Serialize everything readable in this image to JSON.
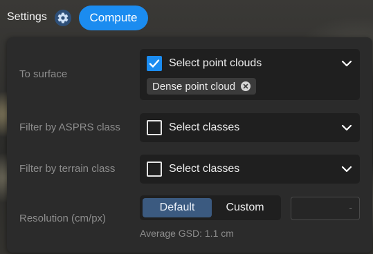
{
  "topbar": {
    "settings_label": "Settings",
    "compute_label": "Compute"
  },
  "icons": {
    "gear": "gear-icon",
    "check": "checkmark-icon",
    "chevron": "chevron-down-icon",
    "chip_remove": "close-circle-icon"
  },
  "colors": {
    "accent": "#1b8cf0",
    "segment_active": "#3b5a80",
    "panel": "#2b2b2b"
  },
  "rows": {
    "surface": {
      "label": "To surface",
      "checked": true,
      "select_text": "Select point clouds",
      "chips": [
        "Dense point cloud"
      ]
    },
    "asprs": {
      "label": "Filter by ASPRS class",
      "checked": false,
      "select_text": "Select classes"
    },
    "terrain": {
      "label": "Filter by terrain class",
      "checked": false,
      "select_text": "Select classes"
    },
    "resolution": {
      "label": "Resolution (cm/px)",
      "options": [
        "Default",
        "Custom"
      ],
      "selected": "Default",
      "custom_value_placeholder": "-",
      "gsd_text": "Average GSD: 1.1 cm"
    }
  }
}
